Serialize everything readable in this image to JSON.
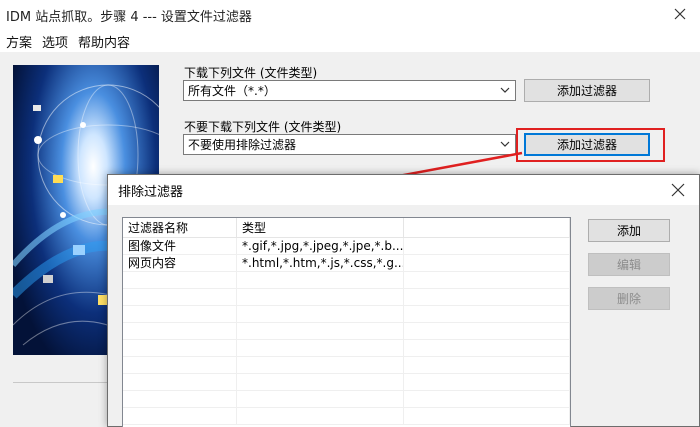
{
  "window": {
    "title": "IDM 站点抓取。步骤 4 --- 设置文件过滤器"
  },
  "menu": {
    "items": [
      "方案",
      "选项",
      "帮助内容"
    ]
  },
  "download": {
    "label": "下载下列文件 (文件类型)",
    "selected": "所有文件（*.*）",
    "add_button": "添加过滤器"
  },
  "exclude": {
    "label": "不要下载下列文件 (文件类型)",
    "selected": "不要使用排除过滤器",
    "add_button": "添加过滤器"
  },
  "dialog": {
    "title": "排除过滤器",
    "columns": [
      "过滤器名称",
      "类型"
    ],
    "rows": [
      {
        "name": "图像文件",
        "type": "*.gif,*.jpg,*.jpeg,*.jpe,*.b..."
      },
      {
        "name": "网页内容",
        "type": "*.html,*.htm,*.js,*.css,*.g..."
      }
    ],
    "buttons": {
      "add": "添加",
      "edit": "编辑",
      "delete": "删除"
    }
  },
  "colors": {
    "highlight": "#e02020",
    "focus": "#0078d7"
  },
  "icons": [
    "close-icon",
    "chevron-down-icon",
    "red-arrow-annotation"
  ]
}
